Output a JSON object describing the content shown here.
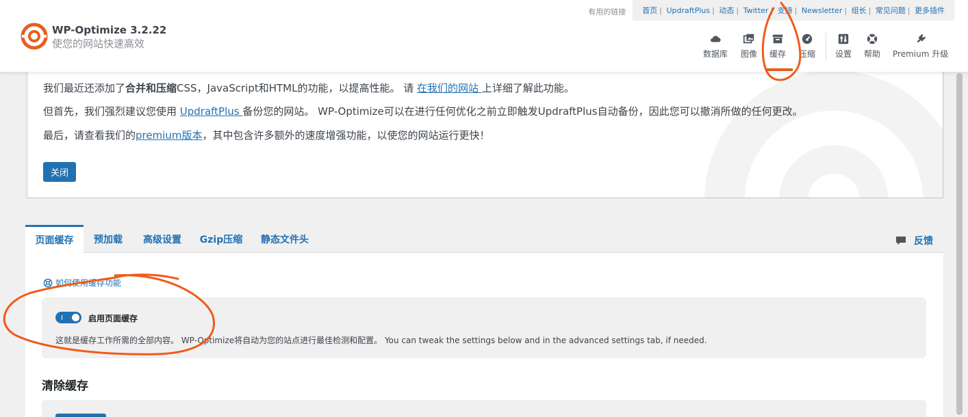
{
  "header": {
    "useful_links_label": "有用的链接",
    "links": [
      "首页",
      "UpdraftPlus",
      "动态",
      "Twitter",
      "支持",
      "Newsletter",
      "组长",
      "常见问题",
      "更多插件"
    ],
    "brand_title": "WP-Optimize 3.2.22",
    "brand_subtitle": "使您的网站快速高效",
    "nav": [
      {
        "label": "数据库",
        "icon": "cloud-icon"
      },
      {
        "label": "图像",
        "icon": "images-icon"
      },
      {
        "label": "缓存",
        "icon": "archive-icon",
        "active": true
      },
      {
        "label": "压缩",
        "icon": "dashboard-icon"
      },
      {
        "label": "设置",
        "icon": "settings-icon"
      },
      {
        "label": "帮助",
        "icon": "help-icon"
      },
      {
        "label": "Premium 升级",
        "icon": "plug-icon"
      }
    ]
  },
  "notice": {
    "line1_pre": "我们最近还添加了",
    "line1_bold": "合并和压缩",
    "line1_mid": "CSS，JavaScript和HTML的功能，以提高性能。 请 ",
    "line1_link": "在我们的网站 ",
    "line1_post": "上详细了解此功能。",
    "line2_pre": "但首先，我们强烈建议您使用 ",
    "line2_link": "UpdraftPlus ",
    "line2_post": "备份您的网站。 WP-Optimize可以在进行任何优化之前立即触发UpdraftPlus自动备份，因此您可以撤消所做的任何更改。",
    "line3_pre": "最后，请查看我们的",
    "line3_link": "premium版本",
    "line3_post": "，其中包含许多额外的速度增强功能，以使您的网站运行更快！",
    "close_label": "关闭"
  },
  "tabs": [
    "页面缓存",
    "预加载",
    "高级设置",
    "Gzip压缩",
    "静态文件头"
  ],
  "feedback_label": "反馈",
  "page_cache": {
    "help_link": "如何使用缓存功能",
    "enable_label": "启用页面缓存",
    "enabled": true,
    "description": "这就是缓存工作所需的全部内容。 WP-Optimize将自动为您的站点进行最佳检测和配置。 You can tweak the settings below and in the advanced settings tab, if needed.",
    "purge_title": "清除缓存"
  },
  "colors": {
    "accent": "#2271b1",
    "brand_orange": "#e85d21",
    "annotation": "#f05a1a"
  }
}
